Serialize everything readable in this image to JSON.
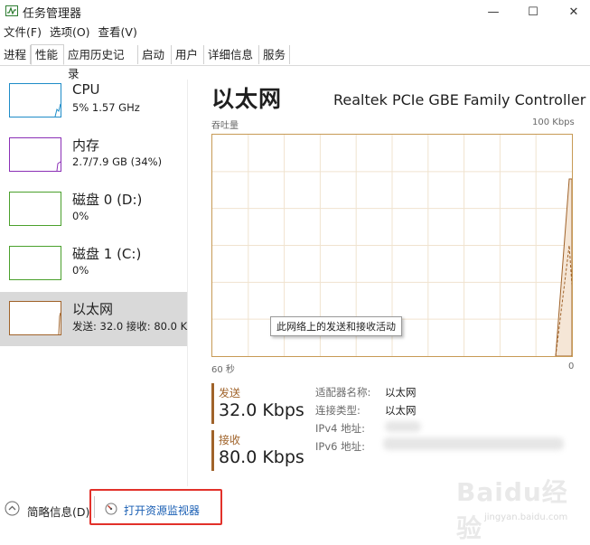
{
  "window": {
    "title": "任务管理器",
    "controls": {
      "minimize": "—",
      "maximize": "☐",
      "close": "✕"
    }
  },
  "menu": [
    "文件(F)",
    "选项(O)",
    "查看(V)"
  ],
  "tabs": [
    "进程",
    "性能",
    "应用历史记录",
    "启动",
    "用户",
    "详细信息",
    "服务"
  ],
  "active_tab": "性能",
  "resources": [
    {
      "name": "CPU",
      "sub": "5%  1.57 GHz",
      "color": "#1e8cc8"
    },
    {
      "name": "内存",
      "sub": "2.7/7.9 GB (34%)",
      "color": "#8b2fb6"
    },
    {
      "name": "磁盘 0 (D:)",
      "sub": "0%",
      "color": "#4aa02c"
    },
    {
      "name": "磁盘 1 (C:)",
      "sub": "0%",
      "color": "#4aa02c"
    },
    {
      "name": "以太网",
      "sub": "发送: 32.0  接收: 80.0 K",
      "color": "#a0632a"
    }
  ],
  "detail": {
    "title": "以太网",
    "adapter": "Realtek PCIe GBE Family Controller",
    "graph_label_left": "吞吐量",
    "graph_label_right": "100 Kbps",
    "axis_left": "60 秒",
    "axis_right": "0",
    "tooltip": "此网络上的发送和接收活动",
    "send_label": "发送",
    "send_value": "32.0 Kbps",
    "recv_label": "接收",
    "recv_value": "80.0 Kbps",
    "adapter_name_key": "适配器名称:",
    "adapter_name_val": "以太网",
    "conn_type_key": "连接类型:",
    "conn_type_val": "以太网",
    "ipv4_key": "IPv4 地址:",
    "ipv6_key": "IPv6 地址:"
  },
  "chart_data": {
    "type": "area",
    "x_range_seconds": [
      60,
      0
    ],
    "y_range_kbps": [
      0,
      100
    ],
    "series": [
      {
        "name": "接收",
        "samples_recent": [
          0,
          80,
          80
        ]
      },
      {
        "name": "发送",
        "samples_recent": [
          0,
          50,
          32
        ]
      }
    ]
  },
  "footer": {
    "summary": "简略信息(D)",
    "monitor_link": "打开资源监视器"
  },
  "watermark": {
    "main": "Baidu经验",
    "sub": "jingyan.baidu.com"
  }
}
